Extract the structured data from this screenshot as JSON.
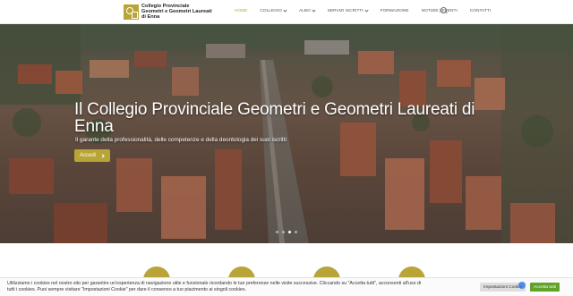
{
  "header": {
    "logo": {
      "line1": "Collegio Provinciale",
      "line2": "Geometri e Geometri Laureati",
      "line3": "di Enna"
    },
    "nav": [
      {
        "label": "HOME",
        "active": true,
        "dropdown": false
      },
      {
        "label": "COLLEGIO",
        "active": false,
        "dropdown": true
      },
      {
        "label": "ALBO",
        "active": false,
        "dropdown": true
      },
      {
        "label": "SERVIZI ISCRITTI",
        "active": false,
        "dropdown": true
      },
      {
        "label": "FORMAZIONE",
        "active": false,
        "dropdown": false
      },
      {
        "label": "NOTIZIE | EVENTI",
        "active": false,
        "dropdown": false
      },
      {
        "label": "CONTATTI",
        "active": false,
        "dropdown": false
      }
    ],
    "search_icon": "search-icon"
  },
  "hero": {
    "title": "Il Collegio Provinciale Geometri e Geometri Laureati di Enna",
    "subtitle": "Il garante della professionalità, delle competenze e della deontologia dei suoi iscritti",
    "button_label": "Accedi",
    "slides": 4,
    "active_slide": 2
  },
  "cookie": {
    "text": "Utilizziamo i cookies nel nostro sito per garantire un'esperienza di navigazione utile e funzionale ricordando le tue preferenze nelle visite successive. Cliccando su \"Accetta tutti\", acconsenti all'uso di tutti i cookies. Puoi sempre visitare \"Impostazioni Cookie\" per dare il consenso a tuo piacimento ai singoli cookies.",
    "settings_label": "Impostazioni Cookie",
    "accept_label": "Accetta tutti"
  },
  "colors": {
    "accent": "#b8a437",
    "accept": "#61a229"
  }
}
